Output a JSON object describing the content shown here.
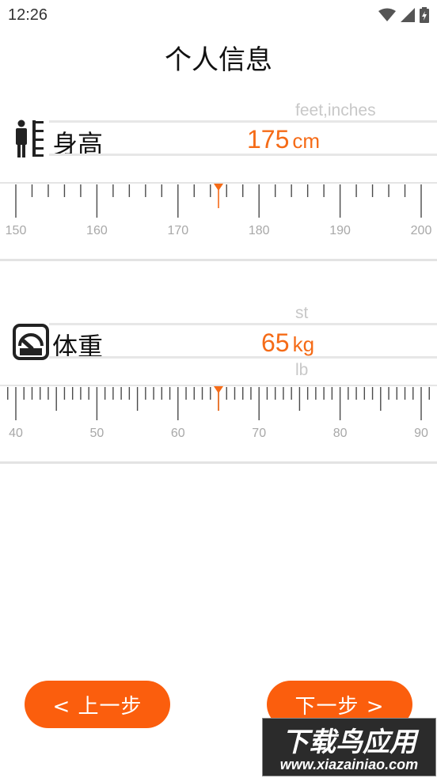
{
  "status_bar": {
    "time": "12:26",
    "icons": [
      "wifi-icon",
      "signal-icon",
      "battery-charging-icon"
    ]
  },
  "title": "个人信息",
  "height": {
    "label": "身高",
    "unit_alt_top": "feet,inches",
    "value": "175",
    "unit": "cm",
    "ruler": {
      "min": 150,
      "max": 200,
      "minor_step": 2,
      "major_step": 10,
      "labels": [
        "150",
        "160",
        "170",
        "180",
        "190",
        "200"
      ],
      "selected": 175
    }
  },
  "weight": {
    "label": "体重",
    "unit_alt_top": "st",
    "unit_alt_bottom": "lb",
    "value": "65",
    "unit": "kg",
    "ruler": {
      "min": 40,
      "max": 90,
      "minor_step": 1,
      "major_step": 10,
      "labels": [
        "40",
        "50",
        "60",
        "70",
        "80",
        "90"
      ],
      "selected": 65
    }
  },
  "buttons": {
    "prev": "< 上一步",
    "next": "下一步 >"
  },
  "watermark": {
    "top": "下载鸟应用",
    "bottom": "www.xiazainiao.com"
  },
  "colors": {
    "accent": "#f56b17",
    "button": "#fb5e0d",
    "muted": "#c8c8c8"
  }
}
